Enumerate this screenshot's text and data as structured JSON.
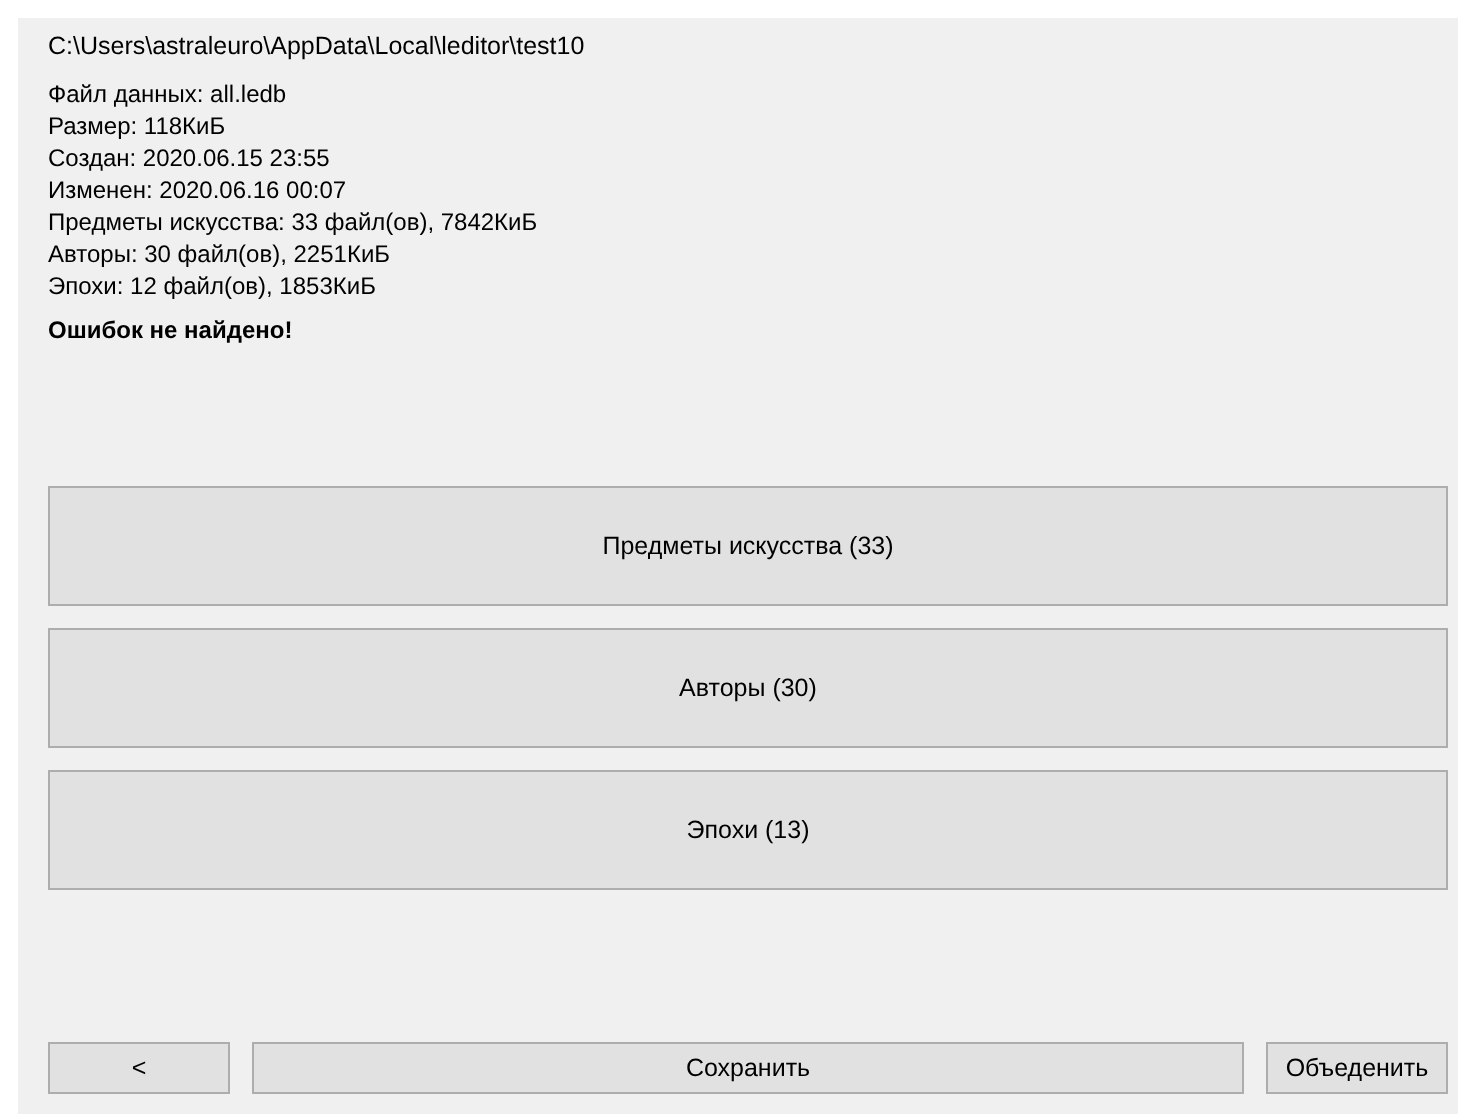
{
  "path": "C:\\Users\\astraleuro\\AppData\\Local\\leditor\\test10",
  "info_lines": [
    "Файл данных: all.ledb",
    "Размер: 118КиБ",
    "Создан: 2020.06.15 23:55",
    "Изменен: 2020.06.16 00:07",
    "Предметы искусства: 33 файл(ов), 7842КиБ",
    "Авторы: 30 файл(ов), 2251КиБ",
    "Эпохи: 12 файл(ов), 1853КиБ"
  ],
  "status": "Ошибок не найдено!",
  "category_buttons": [
    "Предметы искусства (33)",
    "Авторы (30)",
    "Эпохи (13)"
  ],
  "footer_buttons": {
    "back": "<",
    "save": "Сохранить",
    "merge": "Объеденить"
  }
}
